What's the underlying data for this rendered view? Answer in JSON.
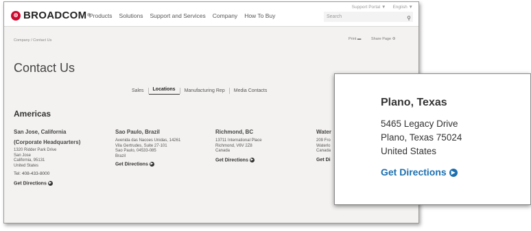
{
  "header": {
    "logo_text": "BROADCOM",
    "logo_tm": "®",
    "nav": [
      "Products",
      "Solutions",
      "Support and Services",
      "Company",
      "How To Buy"
    ],
    "util": {
      "support_portal": "Support Portal ▼",
      "language": "English ▼"
    },
    "search_placeholder": "Search"
  },
  "toolbar": {
    "breadcrumb": "Company / Contact Us",
    "print_label": "Print",
    "share_label": "Share Page"
  },
  "page_title": "Contact Us",
  "tabs": [
    "Sales",
    "Locations",
    "Manufacturing Rep",
    "Media Contacts"
  ],
  "active_tab": "Locations",
  "region": "Americas",
  "locations": [
    {
      "city": "San Jose, California",
      "subtitle": "(Corporate Headquarters)",
      "lines": [
        "1320 Ridder Park Drive",
        "San Jose",
        "California, 95131",
        "United States"
      ],
      "tel": "Tel: 408-433-8000",
      "directions": "Get Directions"
    },
    {
      "city": "Sao Paulo, Brazil",
      "subtitle": "",
      "lines": [
        "Avenida das Nacoes Unidas, 14261",
        "Vila Gertrudes, Suite 27-101",
        "Sao Paulo, 04533-085",
        "Brazil"
      ],
      "tel": "",
      "directions": "Get Directions"
    },
    {
      "city": "Richmond, BC",
      "subtitle": "",
      "lines": [
        "13711 International Place",
        "Richmond, V6V 2Z8",
        "Canada"
      ],
      "tel": "",
      "directions": "Get Directions"
    },
    {
      "city": "Water",
      "subtitle": "",
      "lines": [
        "209 Fro",
        "Waterlo",
        "Canada"
      ],
      "tel": "",
      "directions": "Get Di"
    }
  ],
  "zoom_card": {
    "city": "Plano, Texas",
    "lines": [
      "5465 Legacy Drive",
      "Plano, Texas 75024",
      "United States"
    ],
    "directions": "Get Directions"
  },
  "colors": {
    "brand": "#cc092f",
    "link_blue": "#1a6fb0"
  }
}
